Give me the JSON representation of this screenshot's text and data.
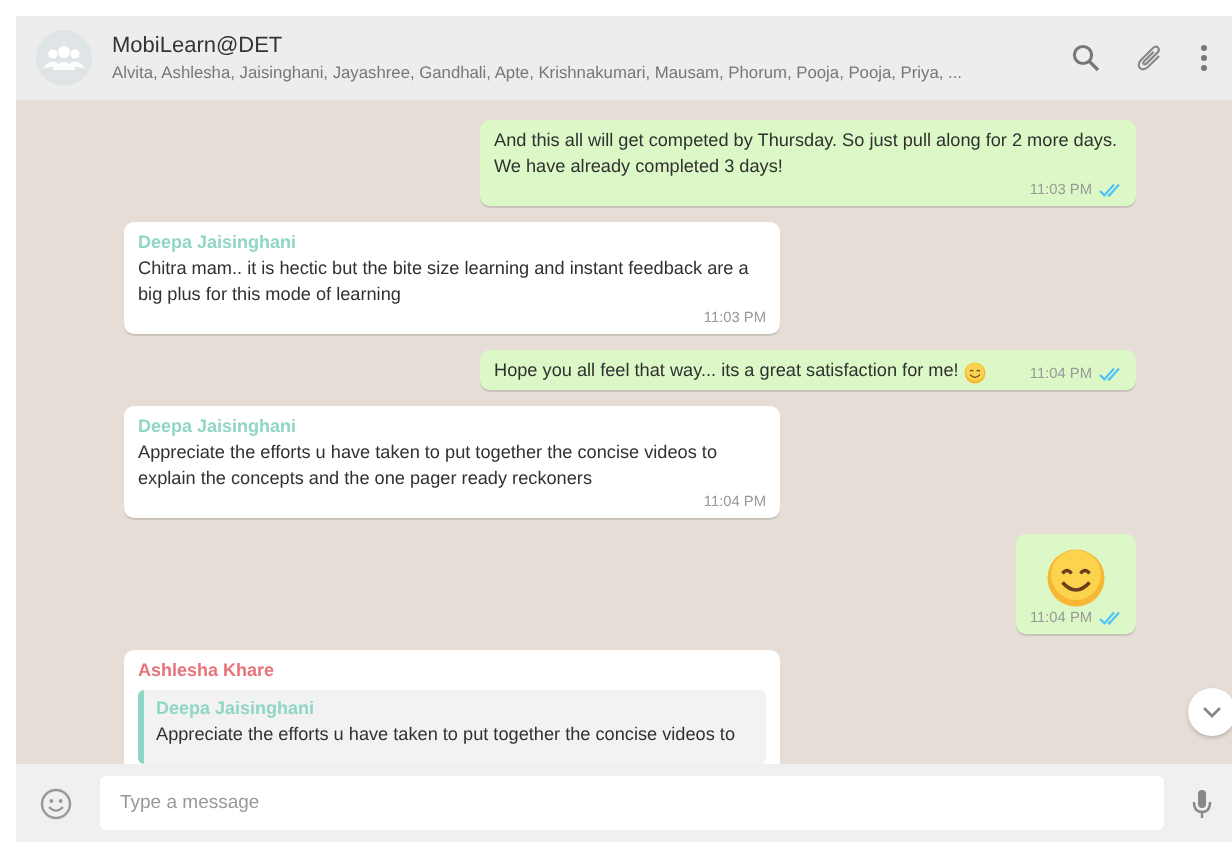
{
  "chat": {
    "title": "MobiLearn@DET",
    "members": "Alvita, Ashlesha, Jaisinghani, Jayashree, Gandhali, Apte, Krishnakumari, Mausam, Phorum, Pooja, Pooja, Priya, ..."
  },
  "messages": [
    {
      "kind": "text",
      "outgoing": true,
      "text": "And this all will get competed by Thursday. So just pull along for 2 more days. We have already completed 3 days!",
      "time": "11:03 PM",
      "read": true,
      "emoji": false
    },
    {
      "kind": "text",
      "outgoing": false,
      "sender": "Deepa Jaisinghani",
      "color": "#8fd6c6",
      "text": "Chitra mam.. it is hectic but the bite size learning and instant feedback are a big plus for this mode of learning",
      "time": "11:03 PM",
      "emoji": false
    },
    {
      "kind": "text",
      "outgoing": true,
      "text": "Hope you all feel that way... its a great satisfaction for me!",
      "time": "11:04 PM",
      "read": true,
      "emoji": true
    },
    {
      "kind": "text",
      "outgoing": false,
      "sender": "Deepa Jaisinghani",
      "color": "#8fd6c6",
      "text": "Appreciate the efforts u have taken to put together the concise videos to explain the concepts and the one pager ready reckoners",
      "time": "11:04 PM",
      "emoji": false
    },
    {
      "kind": "emoji",
      "outgoing": true,
      "time": "11:04 PM",
      "read": true
    },
    {
      "kind": "reply",
      "outgoing": false,
      "sender": "Ashlesha Khare",
      "color": "#e8737a",
      "quote": {
        "sender": "Deepa Jaisinghani",
        "color": "#8fd6c6",
        "text": "Appreciate the efforts u have taken to put together the concise videos to"
      }
    }
  ],
  "composer": {
    "placeholder": "Type a message"
  }
}
